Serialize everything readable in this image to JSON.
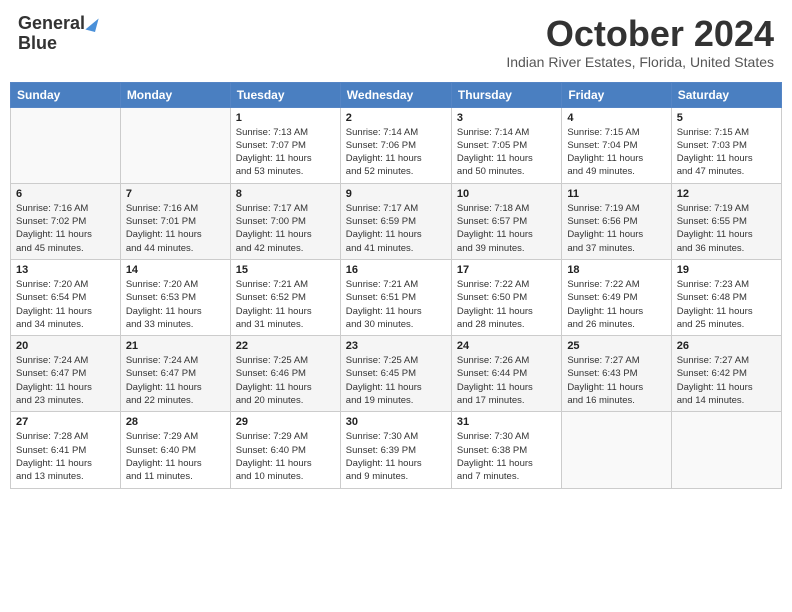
{
  "header": {
    "logo_line1": "General",
    "logo_line2": "Blue",
    "month": "October 2024",
    "location": "Indian River Estates, Florida, United States"
  },
  "days_of_week": [
    "Sunday",
    "Monday",
    "Tuesday",
    "Wednesday",
    "Thursday",
    "Friday",
    "Saturday"
  ],
  "weeks": [
    [
      {
        "day": "",
        "info": ""
      },
      {
        "day": "",
        "info": ""
      },
      {
        "day": "1",
        "info": "Sunrise: 7:13 AM\nSunset: 7:07 PM\nDaylight: 11 hours\nand 53 minutes."
      },
      {
        "day": "2",
        "info": "Sunrise: 7:14 AM\nSunset: 7:06 PM\nDaylight: 11 hours\nand 52 minutes."
      },
      {
        "day": "3",
        "info": "Sunrise: 7:14 AM\nSunset: 7:05 PM\nDaylight: 11 hours\nand 50 minutes."
      },
      {
        "day": "4",
        "info": "Sunrise: 7:15 AM\nSunset: 7:04 PM\nDaylight: 11 hours\nand 49 minutes."
      },
      {
        "day": "5",
        "info": "Sunrise: 7:15 AM\nSunset: 7:03 PM\nDaylight: 11 hours\nand 47 minutes."
      }
    ],
    [
      {
        "day": "6",
        "info": "Sunrise: 7:16 AM\nSunset: 7:02 PM\nDaylight: 11 hours\nand 45 minutes."
      },
      {
        "day": "7",
        "info": "Sunrise: 7:16 AM\nSunset: 7:01 PM\nDaylight: 11 hours\nand 44 minutes."
      },
      {
        "day": "8",
        "info": "Sunrise: 7:17 AM\nSunset: 7:00 PM\nDaylight: 11 hours\nand 42 minutes."
      },
      {
        "day": "9",
        "info": "Sunrise: 7:17 AM\nSunset: 6:59 PM\nDaylight: 11 hours\nand 41 minutes."
      },
      {
        "day": "10",
        "info": "Sunrise: 7:18 AM\nSunset: 6:57 PM\nDaylight: 11 hours\nand 39 minutes."
      },
      {
        "day": "11",
        "info": "Sunrise: 7:19 AM\nSunset: 6:56 PM\nDaylight: 11 hours\nand 37 minutes."
      },
      {
        "day": "12",
        "info": "Sunrise: 7:19 AM\nSunset: 6:55 PM\nDaylight: 11 hours\nand 36 minutes."
      }
    ],
    [
      {
        "day": "13",
        "info": "Sunrise: 7:20 AM\nSunset: 6:54 PM\nDaylight: 11 hours\nand 34 minutes."
      },
      {
        "day": "14",
        "info": "Sunrise: 7:20 AM\nSunset: 6:53 PM\nDaylight: 11 hours\nand 33 minutes."
      },
      {
        "day": "15",
        "info": "Sunrise: 7:21 AM\nSunset: 6:52 PM\nDaylight: 11 hours\nand 31 minutes."
      },
      {
        "day": "16",
        "info": "Sunrise: 7:21 AM\nSunset: 6:51 PM\nDaylight: 11 hours\nand 30 minutes."
      },
      {
        "day": "17",
        "info": "Sunrise: 7:22 AM\nSunset: 6:50 PM\nDaylight: 11 hours\nand 28 minutes."
      },
      {
        "day": "18",
        "info": "Sunrise: 7:22 AM\nSunset: 6:49 PM\nDaylight: 11 hours\nand 26 minutes."
      },
      {
        "day": "19",
        "info": "Sunrise: 7:23 AM\nSunset: 6:48 PM\nDaylight: 11 hours\nand 25 minutes."
      }
    ],
    [
      {
        "day": "20",
        "info": "Sunrise: 7:24 AM\nSunset: 6:47 PM\nDaylight: 11 hours\nand 23 minutes."
      },
      {
        "day": "21",
        "info": "Sunrise: 7:24 AM\nSunset: 6:47 PM\nDaylight: 11 hours\nand 22 minutes."
      },
      {
        "day": "22",
        "info": "Sunrise: 7:25 AM\nSunset: 6:46 PM\nDaylight: 11 hours\nand 20 minutes."
      },
      {
        "day": "23",
        "info": "Sunrise: 7:25 AM\nSunset: 6:45 PM\nDaylight: 11 hours\nand 19 minutes."
      },
      {
        "day": "24",
        "info": "Sunrise: 7:26 AM\nSunset: 6:44 PM\nDaylight: 11 hours\nand 17 minutes."
      },
      {
        "day": "25",
        "info": "Sunrise: 7:27 AM\nSunset: 6:43 PM\nDaylight: 11 hours\nand 16 minutes."
      },
      {
        "day": "26",
        "info": "Sunrise: 7:27 AM\nSunset: 6:42 PM\nDaylight: 11 hours\nand 14 minutes."
      }
    ],
    [
      {
        "day": "27",
        "info": "Sunrise: 7:28 AM\nSunset: 6:41 PM\nDaylight: 11 hours\nand 13 minutes."
      },
      {
        "day": "28",
        "info": "Sunrise: 7:29 AM\nSunset: 6:40 PM\nDaylight: 11 hours\nand 11 minutes."
      },
      {
        "day": "29",
        "info": "Sunrise: 7:29 AM\nSunset: 6:40 PM\nDaylight: 11 hours\nand 10 minutes."
      },
      {
        "day": "30",
        "info": "Sunrise: 7:30 AM\nSunset: 6:39 PM\nDaylight: 11 hours\nand 9 minutes."
      },
      {
        "day": "31",
        "info": "Sunrise: 7:30 AM\nSunset: 6:38 PM\nDaylight: 11 hours\nand 7 minutes."
      },
      {
        "day": "",
        "info": ""
      },
      {
        "day": "",
        "info": ""
      }
    ]
  ]
}
